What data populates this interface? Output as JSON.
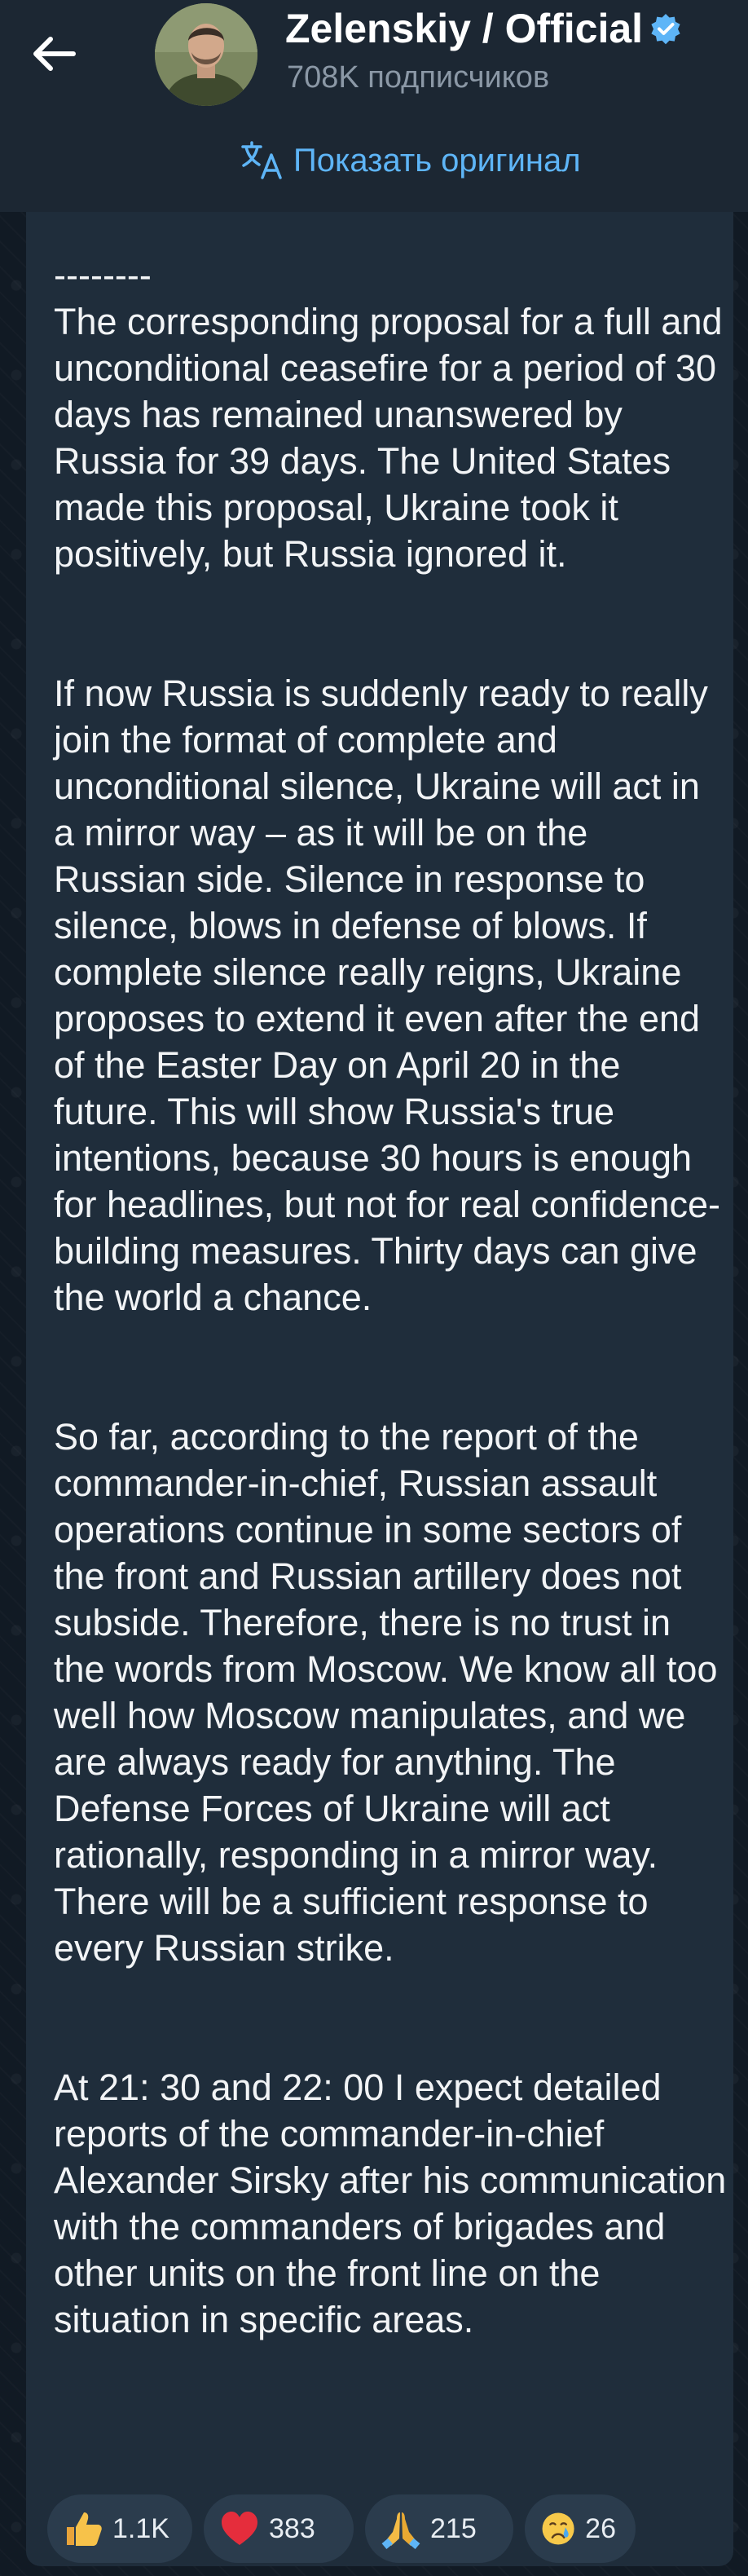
{
  "header": {
    "channel_title": "Zelenskiy / Official",
    "subscribers": "708K подписчиков",
    "verified": true
  },
  "translate": {
    "label": "Показать оригинал"
  },
  "message": {
    "paragraphs": [
      "--------\nThe corresponding proposal for a full and unconditional ceasefire for a period of 30 days has remained unanswered by Russia for 39 days. The United States made this proposal, Ukraine took it positively, but Russia ignored it.",
      "If now Russia is suddenly ready to really join the format of complete and unconditional silence, Ukraine will act in a mirror way – as it will be on the Russian side. Silence in response to silence, blows in defense of blows. If complete silence really reigns, Ukraine proposes to extend it even after the end of the Easter Day on April 20 in the future. This will show Russia's true intentions, because 30 hours is enough for headlines, but not for real confidence-building measures. Thirty days can give the world a chance.",
      "So far, according to the report of the commander-in-chief, Russian assault operations continue in some sectors of the front and Russian artillery does not subside. Therefore, there is no trust in the words from Moscow. We know all too well how Moscow manipulates, and we are always ready for anything. The Defense Forces of Ukraine will act rationally, responding in a mirror way. There will be a sufficient response to every Russian strike.",
      "At 21: 30 and 22: 00 I expect detailed reports of the commander-in-chief Alexander Sirsky after his communication with the commanders of brigades and other units on the front line on the situation in specific areas."
    ]
  },
  "reactions": [
    {
      "icon": "thumbs-up-icon",
      "count": "1.1K"
    },
    {
      "icon": "heart-icon",
      "count": "383"
    },
    {
      "icon": "praying-hands-icon",
      "count": "215"
    },
    {
      "icon": "crying-face-icon",
      "count": "26"
    }
  ],
  "colors": {
    "topbar": "#1c2733",
    "bubble": "#1f2d3b",
    "accent": "#5eb5f7",
    "reaction_bg": "#2b3c4d"
  }
}
